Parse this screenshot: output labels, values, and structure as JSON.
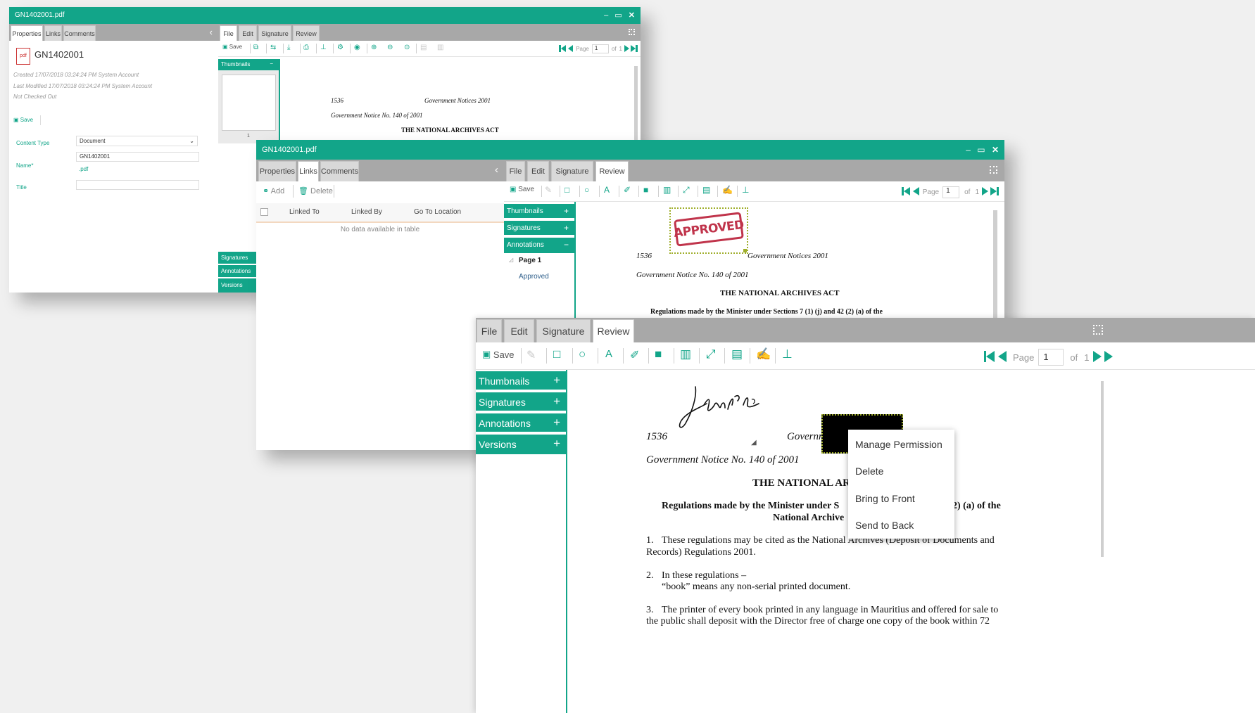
{
  "w1": {
    "title": "GN1402001.pdf",
    "ctrl_min": "‒",
    "ctrl_max": "▭",
    "ctrl_close": "✕",
    "left_tabs": [
      "Properties",
      "Links",
      "Comments"
    ],
    "collapse": "‹",
    "doc_name": "GN1402001",
    "created": "Created 17/07/2018 03:24:24 PM System Account",
    "modified": "Last Modified 17/07/2018 03:24:24 PM System Account",
    "checkout": "Not Checked Out",
    "save": "Save",
    "content_type_label": "Content Type",
    "content_type_value": "Document",
    "name_label": "Name*",
    "name_value": "GN1402001",
    "ext": ".pdf",
    "title_label": "Title",
    "title_value": "",
    "right_tabs": [
      "File",
      "Edit",
      "Signature",
      "Review"
    ],
    "page_label": "Page",
    "page_num": "1",
    "of_label": "of",
    "page_total": "1",
    "thumbnails": "Thumbnails",
    "thumb_page": "1",
    "minus": "−",
    "panels": [
      "Signatures",
      "Annotations",
      "Versions"
    ],
    "doc_lines": {
      "num": "1536",
      "header": "Government Notices 2001",
      "notice": "Government Notice No. 140 of 2001",
      "act": "THE NATIONAL ARCHIVES ACT"
    }
  },
  "w2": {
    "title": "GN1402001.pdf",
    "left_tabs": [
      "Properties",
      "Links",
      "Comments"
    ],
    "collapse": "‹",
    "add": "Add",
    "delete": "Delete",
    "columns": [
      "Linked To",
      "Linked By",
      "Go To Location"
    ],
    "empty": "No data available in table",
    "right_tabs": [
      "File",
      "Edit",
      "Signature",
      "Review"
    ],
    "save": "Save",
    "page_label": "Page",
    "page_num": "1",
    "of_label": "of",
    "page_total": "1",
    "panels": [
      "Thumbnails",
      "Signatures",
      "Annotations"
    ],
    "plus": "+",
    "minus": "−",
    "tree_page": "Page 1",
    "tree_item": "Approved",
    "stamp": "APPROVED",
    "doc_lines": {
      "num": "1536",
      "header": "Government Notices 2001",
      "notice": "Government Notice No. 140 of 2001",
      "act": "THE NATIONAL ARCHIVES ACT",
      "reg": "Regulations made by the Minister under Sections 7 (1) (j) and 42 (2) (a) of the"
    }
  },
  "w3": {
    "right_tabs": [
      "File",
      "Edit",
      "Signature",
      "Review"
    ],
    "save": "Save",
    "page_label": "Page",
    "page_num": "1",
    "of_label": "of",
    "page_total": "1",
    "panels": [
      "Thumbnails",
      "Signatures",
      "Annotations",
      "Versions"
    ],
    "plus": "+",
    "doc_lines": {
      "num": "1536",
      "header_part": "Governm",
      "notice": "Government Notice No. 140 of 2001",
      "act_part": "THE NATIONAL AR",
      "reg_part": "Regulations made by the Minister under S",
      "reg_tail": "2) (a) of the",
      "archive_part": "National Archive",
      "p1_num": "1.",
      "p1_a": "These regulations may be cited as the National Archives (Deposit of Documents and",
      "p1_b": "Records) Regulations 2001.",
      "p2_num": "2.",
      "p2_a": "In these regulations –",
      "p2_b": "“book” means any non-serial printed document.",
      "p3_num": "3.",
      "p3_a": "The printer of every book printed in any language in Mauritius and offered for sale to",
      "p3_b": "the public shall deposit with the Director free of charge one copy of the book within 72"
    },
    "context_menu": [
      "Manage Permission",
      "Delete",
      "Bring to Front",
      "Send to Back"
    ]
  },
  "colors": {
    "accent": "#12a589",
    "tabbar": "#a8a8a8",
    "redaction": "#000000",
    "stamp": "#c0344b"
  }
}
